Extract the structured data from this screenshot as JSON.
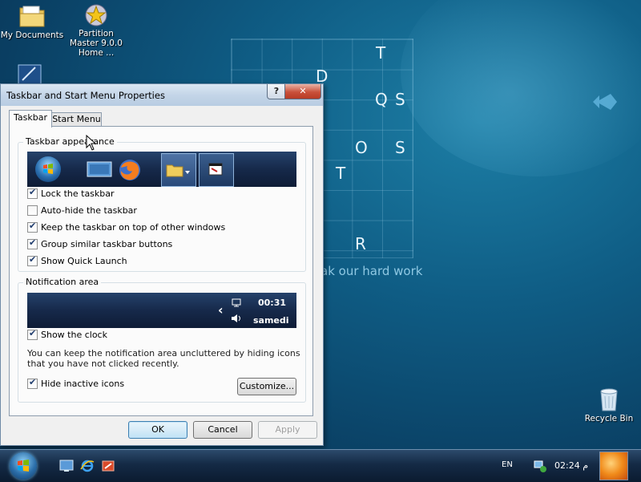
{
  "desktop": {
    "icons": [
      {
        "label": "My Documents",
        "name": "my-documents"
      },
      {
        "label": "Partition Master 9.0.0 Home ...",
        "name": "partition-master"
      },
      {
        "label": "Recycle Bin",
        "name": "recycle-bin"
      }
    ],
    "wallpaper_letters": [
      "T",
      "D",
      "Q",
      "S",
      "O",
      "S",
      "T",
      "R"
    ],
    "wallpaper_tagline": "ak our hard work"
  },
  "dialog": {
    "title": "Taskbar and Start Menu Properties",
    "help_button": "?",
    "close_button": "✕",
    "tabs": [
      {
        "label": "Taskbar",
        "active": true
      },
      {
        "label": "Start Menu",
        "active": false
      }
    ],
    "appearance_group": {
      "label": "Taskbar appearance",
      "checkboxes": [
        {
          "label": "Lock the taskbar",
          "checked": true
        },
        {
          "label": "Auto-hide the taskbar",
          "checked": false
        },
        {
          "label": "Keep the taskbar on top of other windows",
          "checked": true
        },
        {
          "label": "Group similar taskbar buttons",
          "checked": true
        },
        {
          "label": "Show Quick Launch",
          "checked": true
        }
      ]
    },
    "notification_group": {
      "label": "Notification area",
      "preview_time": "00:31",
      "preview_day": "samedi",
      "preview_arrow": "‹",
      "checkboxes": [
        {
          "label": "Show the clock",
          "checked": true
        },
        {
          "label": "Hide inactive icons",
          "checked": true
        }
      ],
      "description": "You can keep the notification area uncluttered by hiding icons that you have not clicked recently.",
      "customize_label": "Customize..."
    },
    "buttons": {
      "ok": "OK",
      "cancel": "Cancel",
      "apply": "Apply"
    }
  },
  "taskbar": {
    "language": "EN",
    "clock": "02:24 م"
  },
  "colors": {
    "desktop": "#0f5d85",
    "taskbar": "#142a45",
    "dialog_bg": "#f0f0f0",
    "accent": "#3c7fb1"
  }
}
